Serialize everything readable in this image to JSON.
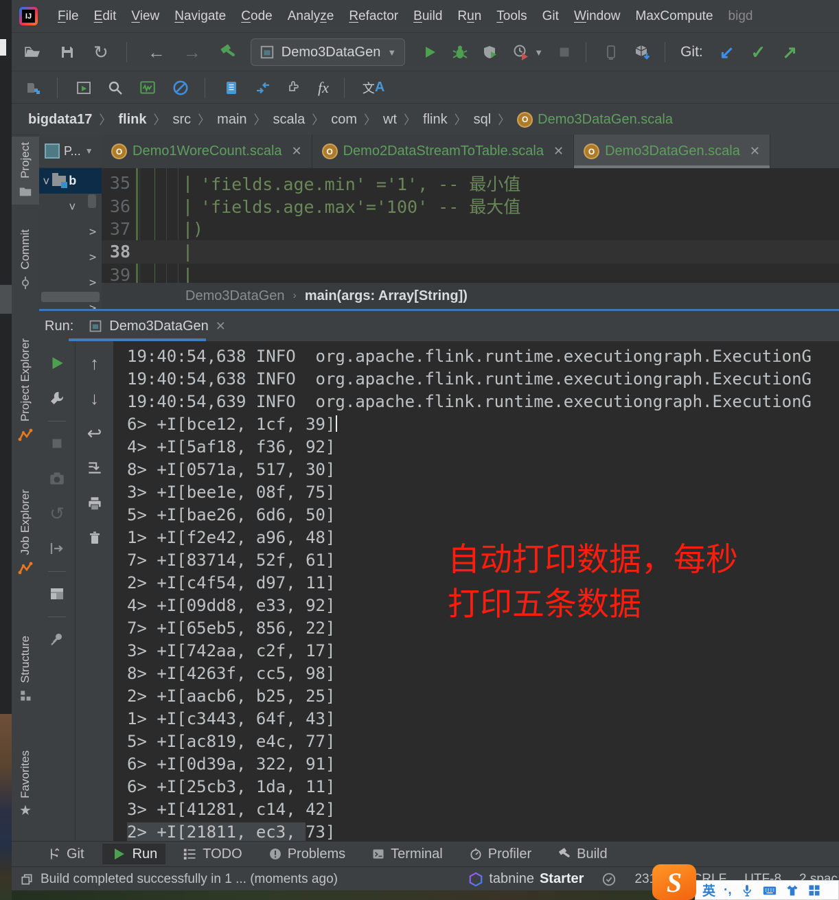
{
  "window": {
    "menu_items": [
      {
        "label": "File",
        "mnemonic": 0
      },
      {
        "label": "Edit",
        "mnemonic": 0
      },
      {
        "label": "View",
        "mnemonic": 0
      },
      {
        "label": "Navigate",
        "mnemonic": 0
      },
      {
        "label": "Code",
        "mnemonic": 0
      },
      {
        "label": "Analyze",
        "mnemonic": 5
      },
      {
        "label": "Refactor",
        "mnemonic": 0
      },
      {
        "label": "Build",
        "mnemonic": 0
      },
      {
        "label": "Run",
        "mnemonic": 1
      },
      {
        "label": "Tools",
        "mnemonic": 0
      },
      {
        "label": "Git",
        "mnemonic": -1
      },
      {
        "label": "Window",
        "mnemonic": 0
      },
      {
        "label": "MaxCompute",
        "mnemonic": -1
      },
      {
        "label": "bigd",
        "mnemonic": -1,
        "dim": true
      }
    ]
  },
  "toolbar": {
    "main_icons": [
      "open-file-icon",
      "save-all-icon",
      "sync-icon",
      "|",
      "back-icon",
      "forward-icon",
      "build-hammer-icon"
    ],
    "run_config": "Demo3DataGen",
    "run_icons": [
      "run-icon",
      "debug-icon",
      "coverage-icon",
      "profiler-run-icon",
      "dropdown-icon",
      "stop-icon",
      "|",
      "attach-device-icon",
      "package-download-icon",
      "|"
    ],
    "git_label": "Git:",
    "git_icons": [
      "git-update-icon",
      "git-commit-icon",
      "git-push-icon"
    ],
    "quick_icons": [
      "modules-icon",
      "|",
      "run-window-icon",
      "search-icon",
      "monitor-icon",
      "blocked-icon",
      "|",
      "notebook-icon",
      "merge-icon",
      "plugin-icon",
      "function-icon",
      "|",
      "translate-icon"
    ]
  },
  "breadcrumbs": {
    "items": [
      "bigdata17",
      "flink",
      "src",
      "main",
      "scala",
      "com",
      "wt",
      "flink",
      "sql"
    ],
    "file": "Demo3DataGen.scala"
  },
  "project_panel": {
    "header": "P...",
    "rows": [
      {
        "chevron": "down",
        "icon": "folder-icon",
        "label": "b",
        "selected": true,
        "indent": 0
      },
      {
        "chevron": "down",
        "indent": 1
      },
      {
        "chevron": "right",
        "indent": 2
      },
      {
        "chevron": "right",
        "indent": 2
      },
      {
        "chevron": "right",
        "indent": 2
      },
      {
        "chevron": "right",
        "indent": 2
      }
    ]
  },
  "editor": {
    "tabs": [
      {
        "label": "Demo1WoreCount.scala",
        "active": false
      },
      {
        "label": "Demo2DataStreamToTable.scala",
        "active": false
      },
      {
        "label": "Demo3DataGen.scala",
        "active": true
      }
    ],
    "lines": [
      {
        "num": "35",
        "margin": "|",
        "code": "'fields.age.min' ='1', -- 最小值",
        "current": false
      },
      {
        "num": "36",
        "margin": "|",
        "code": "'fields.age.max'='100' -- 最大值",
        "current": false
      },
      {
        "num": "37",
        "margin": "|)",
        "code": "",
        "current": false
      },
      {
        "num": "38",
        "margin": "|",
        "code": "",
        "current": true
      },
      {
        "num": "39",
        "margin": "|",
        "code": "",
        "current": false
      }
    ],
    "breadcrumb": {
      "class": "Demo3DataGen",
      "member": "main(args: Array[String])"
    }
  },
  "run_panel": {
    "label": "Run:",
    "tab": "Demo3DataGen",
    "toolbar_icons": [
      "rerun-icon",
      "settings-wrench-icon",
      "|",
      "stop-icon",
      "camera-icon",
      "restart-icon",
      "exit-icon",
      "|",
      "layout-icon",
      "|",
      "pin-icon"
    ],
    "console_icons": [
      "up-icon",
      "down-icon",
      "softwrap-icon",
      "scroll-end-icon",
      "print-icon",
      "clear-icon"
    ],
    "info_lines": [
      {
        "time": "19:40:54,638",
        "level": "INFO",
        "message": "org.apache.flink.runtime.executiongraph.ExecutionG"
      },
      {
        "time": "19:40:54,638",
        "level": "INFO",
        "message": "org.apache.flink.runtime.executiongraph.ExecutionG"
      },
      {
        "time": "19:40:54,639",
        "level": "INFO",
        "message": "org.apache.flink.runtime.executiongraph.ExecutionG"
      }
    ],
    "data_lines": [
      "6> +I[bce12, 1cf, 39]",
      "4> +I[5af18, f36, 92]",
      "8> +I[0571a, 517, 30]",
      "3> +I[bee1e, 08f, 75]",
      "5> +I[bae26, 6d6, 50]",
      "1> +I[f2e42, a96, 48]",
      "7> +I[83714, 52f, 61]",
      "2> +I[c4f54, d97, 11]",
      "4> +I[09dd8, e33, 92]",
      "7> +I[65eb5, 856, 22]",
      "3> +I[742aa, c2f, 17]",
      "8> +I[4263f, cc5, 98]",
      "2> +I[aacb6, b25, 25]",
      "1> +I[c3443, 64f, 43]",
      "5> +I[ac819, e4c, 77]",
      "6> +I[0d39a, 322, 91]",
      "6> +I[25cb3, 1da, 11]",
      "3> +I[41281, c14, 42]",
      "2> +I[21811, ec3, 73]"
    ],
    "caret_line": 0,
    "highlight_line": 18,
    "highlight_chars": 18
  },
  "annotation": {
    "line1": "自动打印数据，每秒",
    "line2": "打印五条数据",
    "color": "#fb1d0e"
  },
  "tool_stripes": [
    {
      "label": "Project",
      "icon": "folder-icon",
      "active": true
    },
    {
      "label": "Commit",
      "icon": "commit-icon",
      "active": false
    },
    {
      "label": "Project Explorer",
      "icon": "flink-icon",
      "active": false
    },
    {
      "label": "Job Explorer",
      "icon": "flink-icon",
      "active": false
    },
    {
      "label": "Structure",
      "icon": "structure-icon",
      "active": false
    },
    {
      "label": "Favorites",
      "icon": "star-icon",
      "active": false
    }
  ],
  "bottom_bar": [
    {
      "label": "Git",
      "icon": "git-branch-icon",
      "active": false
    },
    {
      "label": "Run",
      "icon": "run-icon",
      "active": true
    },
    {
      "label": "TODO",
      "icon": "todo-icon",
      "active": false
    },
    {
      "label": "Problems",
      "icon": "problems-icon",
      "active": false
    },
    {
      "label": "Terminal",
      "icon": "terminal-icon",
      "active": false
    },
    {
      "label": "Profiler",
      "icon": "profiler-icon",
      "active": false
    },
    {
      "label": "Build",
      "icon": "build-icon",
      "active": false
    }
  ],
  "status_bar": {
    "message": "Build completed successfully in 1 ... (moments ago)",
    "tabnine": "tabnine",
    "plan": "Starter",
    "position": "231:23",
    "line_ending": "CRLF",
    "encoding": "UTF-8",
    "indent": "2 spac"
  },
  "ime": {
    "mode": "英",
    "punct": "·,",
    "icons": [
      "mic-icon",
      "keyboard-icon",
      "skin-icon",
      "toolbox-icon"
    ]
  },
  "colors": {
    "accent_blue": "#3f7cc4",
    "string_green": "#6a8759",
    "file_green": "#5f9e5f",
    "annotation_red": "#fb1d0e",
    "flink_orange": "#e8781e"
  }
}
